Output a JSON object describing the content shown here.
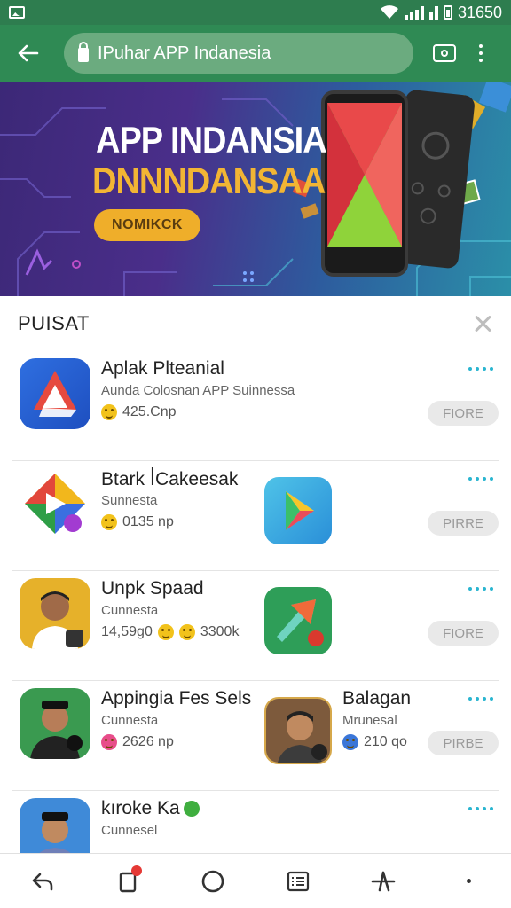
{
  "status": {
    "time": "31650"
  },
  "toolbar": {
    "url": "IPuhar APP Indanesia"
  },
  "banner": {
    "title": "APP INDANSIA",
    "subtitle": "DNNNDANSAA",
    "button_label": "NOMIKCK"
  },
  "section": {
    "title": "PUISAT"
  },
  "apps": [
    {
      "name": "Aplak Plteanial",
      "subtitle": "Aunda Colosnan APP Suinnessa",
      "meta": "425.Cnp",
      "button": "FIORE"
    },
    {
      "name": "Btark ꟾCakeesak",
      "subtitle": "Sunnesta",
      "meta": "0135 np",
      "button": "PIRRE"
    },
    {
      "name": "Unpk Spaad",
      "subtitle": "Cunnesta",
      "meta": "14,59g0",
      "meta2": "3300k",
      "button": "FIORE"
    },
    {
      "name": "Appingia Fes Sels",
      "subtitle": "Cunnesta",
      "meta": "2626 np",
      "name2": "Balagan",
      "subtitle2": "Mrunesal",
      "meta2": "210 qo",
      "button": "PIRBE"
    },
    {
      "name": "kıroke Ka",
      "subtitle": "Cunnesel",
      "button": ""
    }
  ],
  "colors": {
    "status_bar": "#2e7d4f",
    "toolbar": "#2f8a54",
    "accent": "#29b5d0",
    "banner_gold": "#efae2a"
  }
}
